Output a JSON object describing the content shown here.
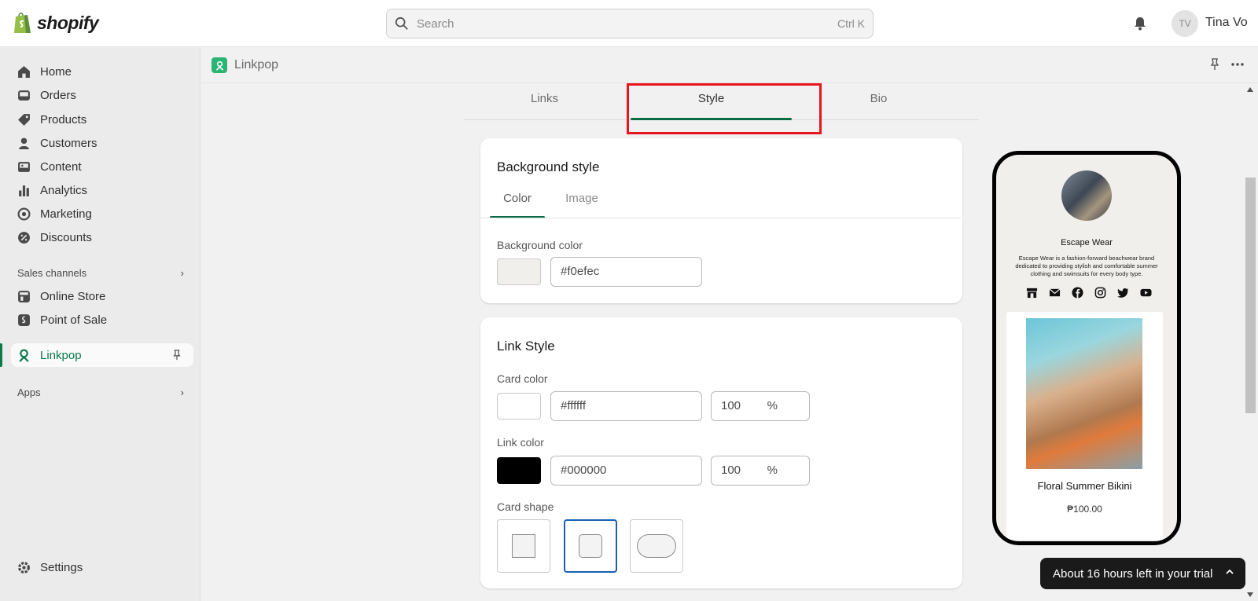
{
  "topbar": {
    "logo_text": "shopify",
    "search_placeholder": "Search",
    "search_shortcut": "Ctrl K",
    "avatar_initials": "TV",
    "user_name": "Tina Vo"
  },
  "sidebar": {
    "items": [
      {
        "label": "Home",
        "icon": "home-icon"
      },
      {
        "label": "Orders",
        "icon": "orders-icon"
      },
      {
        "label": "Products",
        "icon": "tag-icon"
      },
      {
        "label": "Customers",
        "icon": "person-icon"
      },
      {
        "label": "Content",
        "icon": "content-icon"
      },
      {
        "label": "Analytics",
        "icon": "bar-chart-icon"
      },
      {
        "label": "Marketing",
        "icon": "target-icon"
      },
      {
        "label": "Discounts",
        "icon": "discount-icon"
      }
    ],
    "sales_channels_label": "Sales channels",
    "channels": [
      {
        "label": "Online Store",
        "icon": "store-icon"
      },
      {
        "label": "Point of Sale",
        "icon": "pos-icon"
      }
    ],
    "active_app": "Linkpop",
    "apps_label": "Apps",
    "settings_label": "Settings"
  },
  "app": {
    "title": "Linkpop",
    "tabs": [
      "Links",
      "Style",
      "Bio"
    ],
    "active_tab": "Style"
  },
  "background_style": {
    "heading": "Background style",
    "subtabs": [
      "Color",
      "Image"
    ],
    "active_subtab": "Color",
    "color_label": "Background color",
    "color_value": "#f0efec"
  },
  "link_style": {
    "heading": "Link Style",
    "card_color_label": "Card color",
    "card_color_value": "#ffffff",
    "card_opacity": "100",
    "link_color_label": "Link color",
    "link_color_value": "#000000",
    "link_opacity": "100",
    "percent_sign": "%",
    "card_shape_label": "Card shape",
    "shapes": [
      "square",
      "rounded",
      "pill"
    ],
    "selected_shape": "rounded"
  },
  "preview": {
    "name": "Escape Wear",
    "bio": "Escape Wear is a fashion-forward beachwear brand dedicated to providing stylish and comfortable summer clothing and swimsuits for every body type.",
    "social_icons": [
      "store-icon",
      "mail-icon",
      "facebook-icon",
      "instagram-icon",
      "twitter-icon",
      "youtube-icon"
    ],
    "product_title": "Floral Summer Bikini",
    "product_price": "₱100.00"
  },
  "trial_banner": {
    "text": "About 16 hours left in your trial"
  },
  "colors": {
    "accent": "#0b6b47",
    "highlight": "#e8141e",
    "selected_border": "#1a5fb4"
  }
}
